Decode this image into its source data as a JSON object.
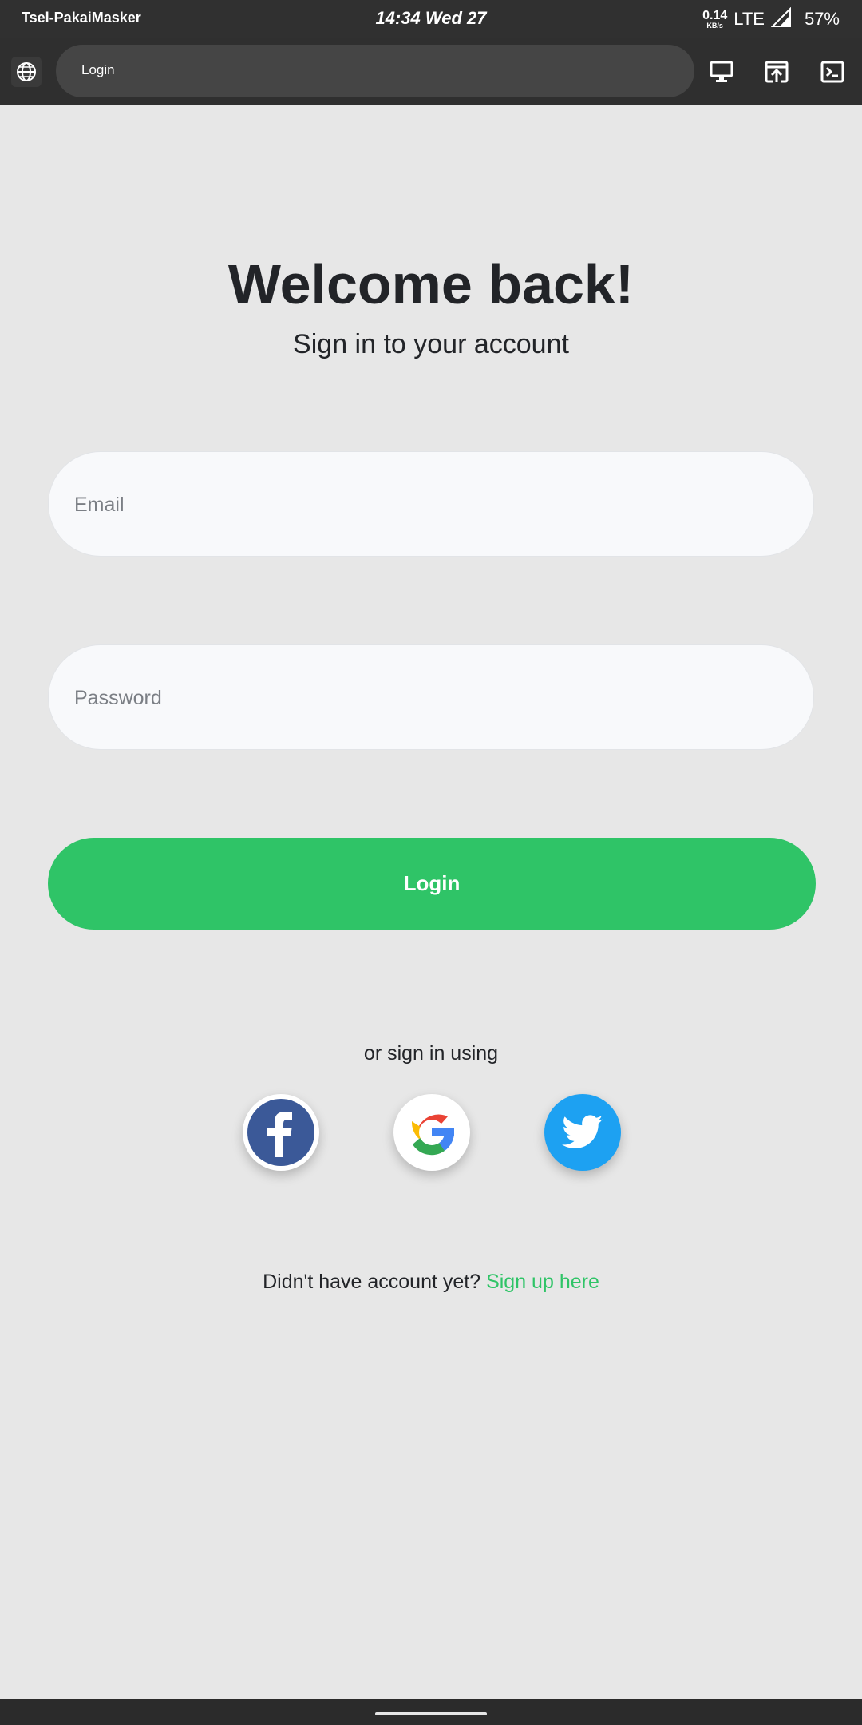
{
  "status_bar": {
    "carrier": "Tsel-PakaiMasker",
    "time": "14:34 Wed 27",
    "net_speed_value": "0.14",
    "net_speed_unit": "KB/s",
    "network": "LTE",
    "battery": "57%"
  },
  "browser": {
    "url_text": "Login",
    "icons": [
      "globe-icon",
      "desktop-icon",
      "open-external-icon",
      "terminal-icon"
    ]
  },
  "login": {
    "title": "Welcome back!",
    "subtitle": "Sign in to your account",
    "email_placeholder": "Email",
    "email_value": "",
    "password_placeholder": "Password",
    "password_value": "",
    "login_label": "Login",
    "or_text": "or sign in using",
    "social": [
      "facebook-icon",
      "google-icon",
      "twitter-icon"
    ],
    "signup_prompt": "Didn't have account yet?",
    "signup_link": "Sign up here"
  },
  "colors": {
    "accent": "#2fc467",
    "background": "#e7e7e7",
    "facebook": "#3b5998",
    "twitter": "#1da1f2"
  }
}
